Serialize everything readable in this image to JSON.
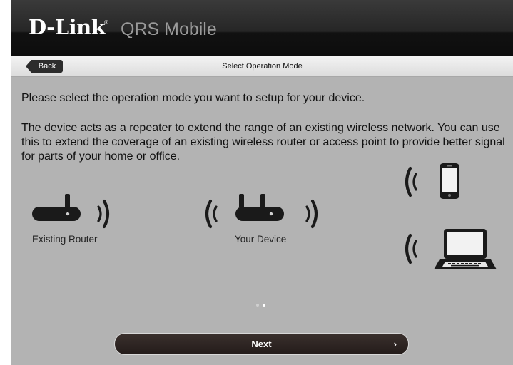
{
  "header": {
    "logo": "D-Link",
    "logo_mark": "®",
    "app_name": "QRS Mobile"
  },
  "nav": {
    "back_label": "Back",
    "title": "Select Operation Mode"
  },
  "content": {
    "intro": "Please select the operation mode you want to setup for your device.",
    "description": "The device acts as a repeater to extend the range of an existing wireless network. You can use this to extend the coverage of an existing wireless router or access point to provide better signal for parts of your home or office."
  },
  "diagram": {
    "existing_router_label": "Existing Router",
    "your_device_label": "Your Device"
  },
  "pager": {
    "current_page": 2,
    "total_pages": 2
  },
  "footer": {
    "next_label": "Next",
    "next_chevron": "›"
  },
  "colors": {
    "background": "#b3b3b3",
    "header": "#1a1a1a",
    "device": "#1a1a1a",
    "next_button": "#2d2421"
  }
}
